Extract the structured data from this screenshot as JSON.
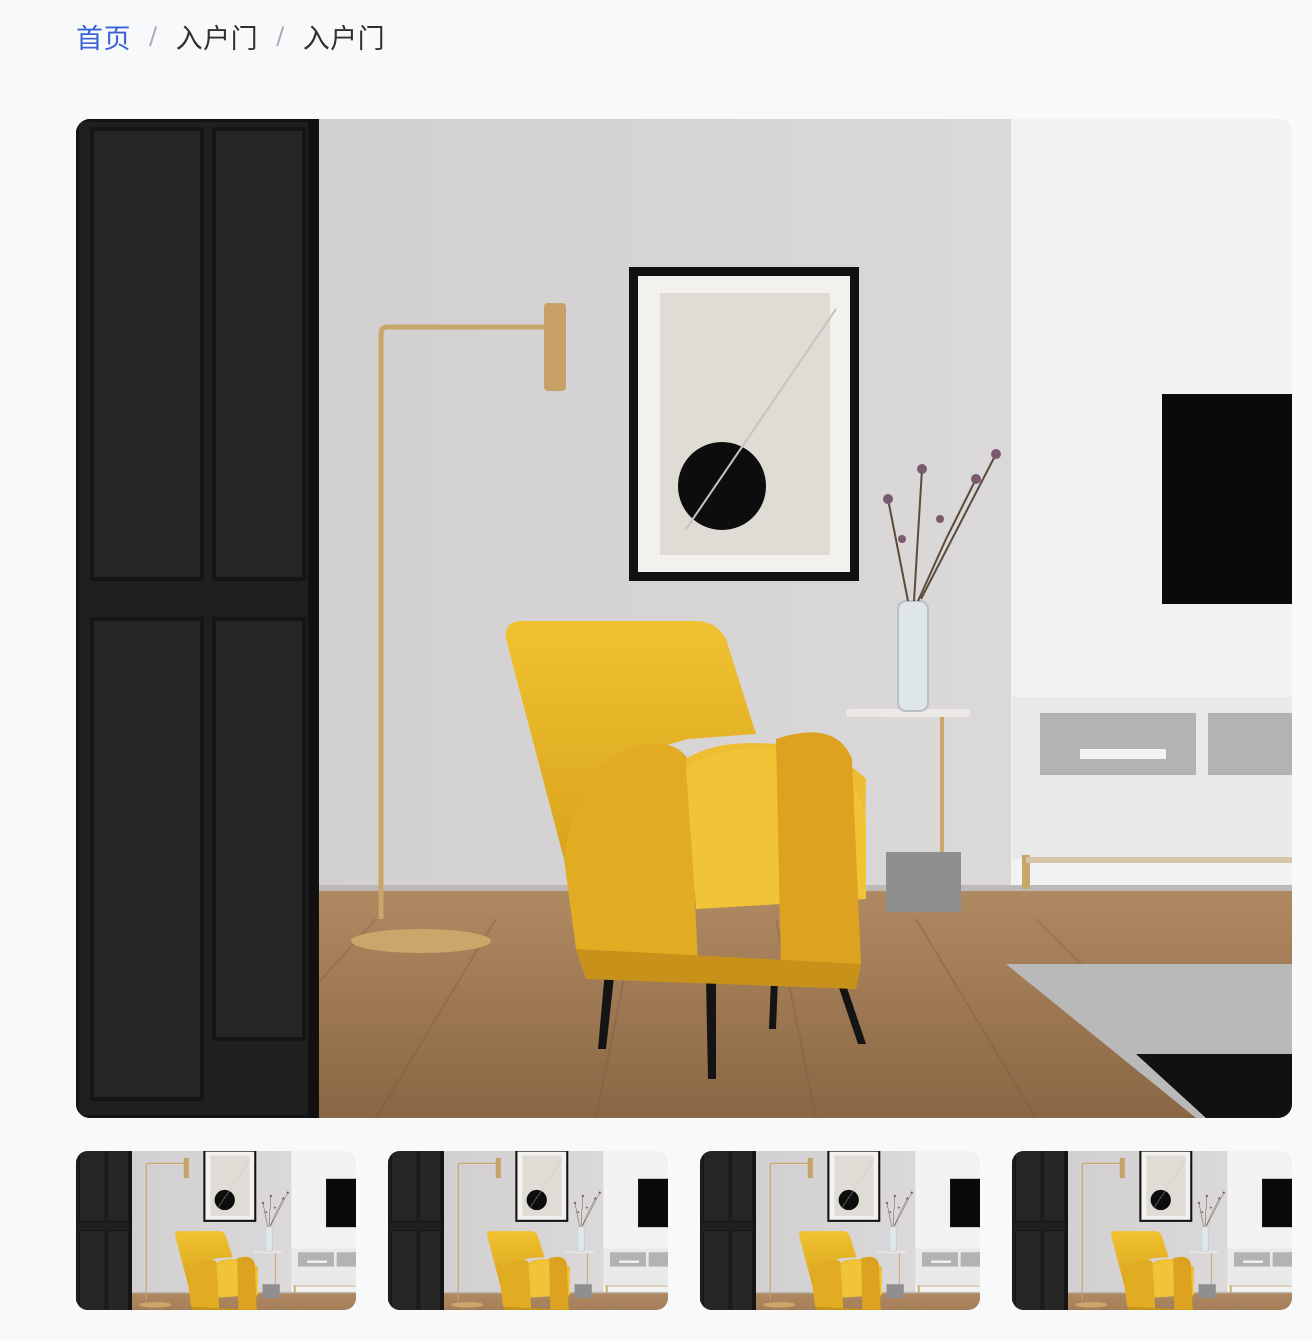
{
  "breadcrumb": {
    "home": "首页",
    "level1": "入户门",
    "current": "入户门"
  },
  "gallery": {
    "main_image": "living-room-photo",
    "thumbnails": [
      {
        "image": "living-room-photo"
      },
      {
        "image": "living-room-photo"
      },
      {
        "image": "living-room-photo"
      },
      {
        "image": "living-room-photo"
      }
    ]
  },
  "colors": {
    "accent": "#3b63d6",
    "text": "#303133",
    "separator": "#a8abb2",
    "background": "#f8f9fb"
  }
}
